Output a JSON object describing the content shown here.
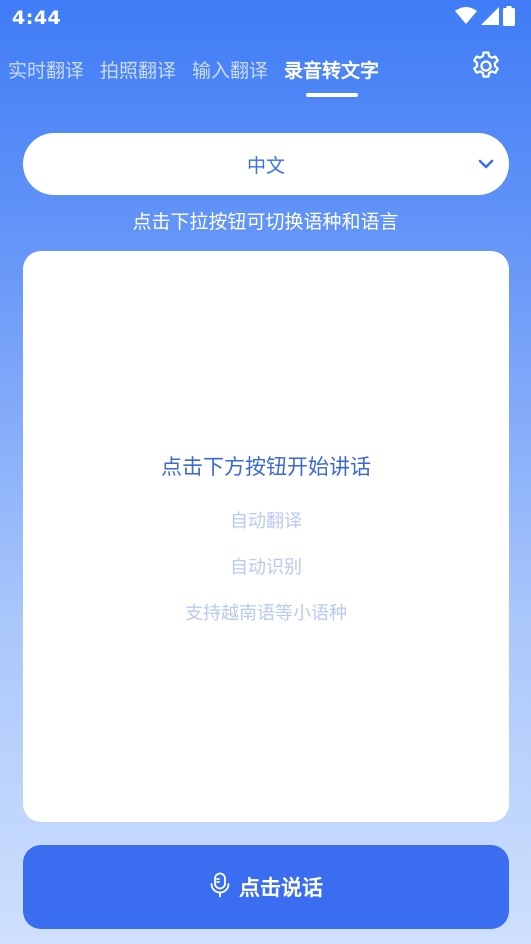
{
  "status_bar": {
    "time": "4:44",
    "icons": [
      "wifi-icon",
      "signal-icon",
      "battery-icon"
    ]
  },
  "tabs": [
    {
      "label": "实时翻译",
      "active": false
    },
    {
      "label": "拍照翻译",
      "active": false
    },
    {
      "label": "输入翻译",
      "active": false
    },
    {
      "label": "录音转文字",
      "active": true
    }
  ],
  "language_select": {
    "selected": "中文"
  },
  "hint": "点击下拉按钮可切换语种和语言",
  "card": {
    "title": "点击下方按钮开始讲话",
    "features": [
      "自动翻译",
      "自动识别",
      "支持越南语等小语种"
    ]
  },
  "talk_button": {
    "label": "点击说话"
  },
  "colors": {
    "accent": "#3A6DF0",
    "gradient_top": "#3F7CF6",
    "gradient_bottom": "#CFE0FD",
    "muted_text": "#B8C9F2"
  }
}
